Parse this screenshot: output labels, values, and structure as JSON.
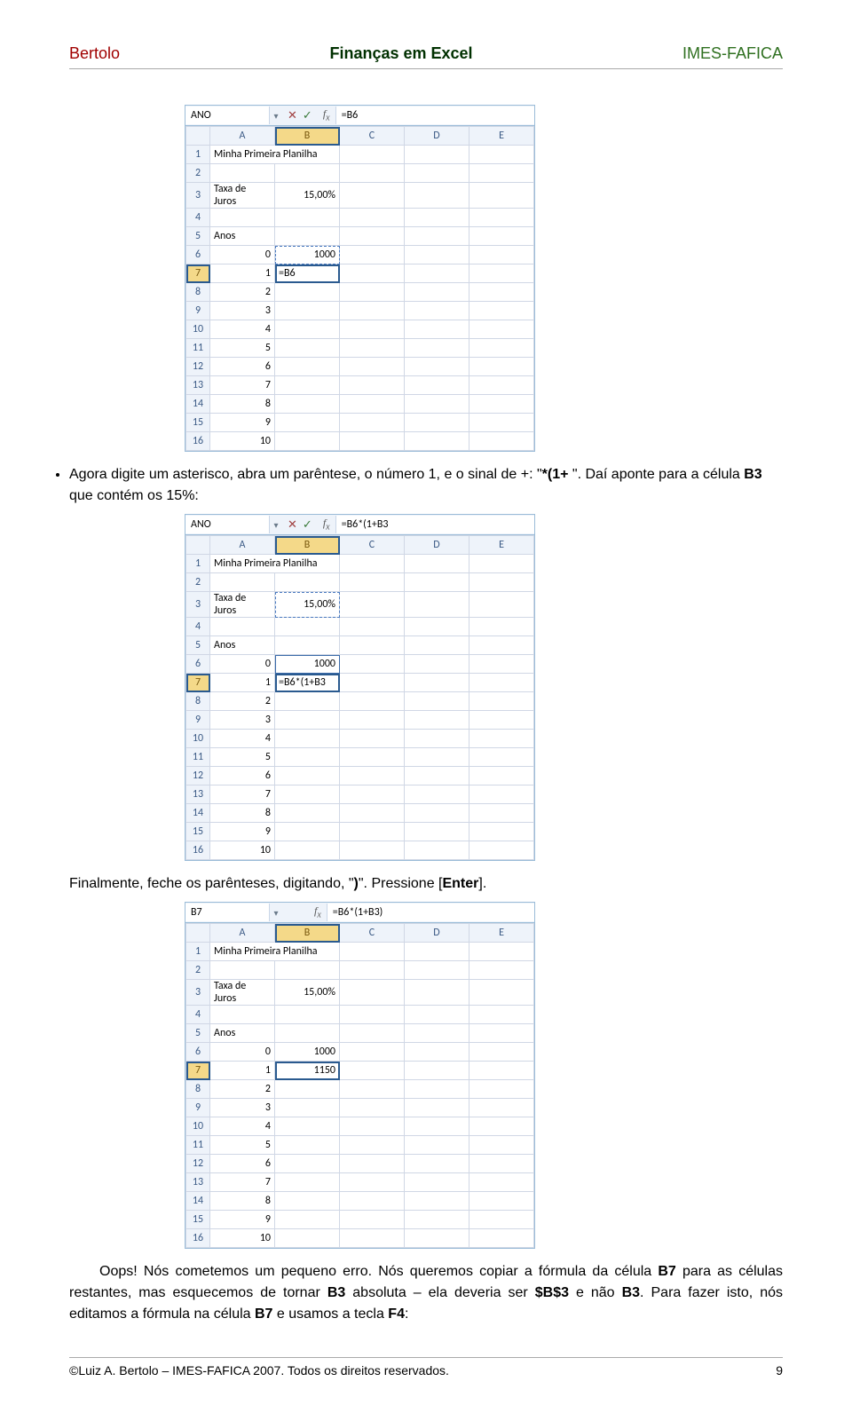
{
  "header": {
    "left": "Bertolo",
    "center": "Finanças em Excel",
    "right": "IMES-FAFICA"
  },
  "excel1": {
    "name": "ANO",
    "formula": "=B6",
    "rows": {
      "r1a": "Minha Primeira Planilha",
      "r3a": "Taxa de Juros",
      "r3b": "15,00%",
      "r5a": "Anos",
      "r6a": "0",
      "r6b": "1000",
      "r7a": "1",
      "r7b": "=B6",
      "r8a": "2",
      "r9a": "3",
      "r10a": "4",
      "r11a": "5",
      "r12a": "6",
      "r13a": "7",
      "r14a": "8",
      "r15a": "9",
      "r16a": "10"
    }
  },
  "bullet1_a": "Agora digite um asterisco, abra um parêntese, o número 1, e o sinal de +: \"",
  "bullet1_code": "*(1+",
  "bullet1_b": " \". Daí aponte para a célula ",
  "bullet1_cell": "B3",
  "bullet1_c": " que contém os 15%:",
  "excel2": {
    "name": "ANO",
    "formula": "=B6*(1+B3",
    "rows": {
      "r1a": "Minha Primeira Planilha",
      "r3a": "Taxa de Juros",
      "r3b": "15,00%",
      "r5a": "Anos",
      "r6a": "0",
      "r6b": "1000",
      "r7a": "1",
      "r7b": "=B6*(1+B3",
      "r8a": "2",
      "r9a": "3",
      "r10a": "4",
      "r11a": "5",
      "r12a": "6",
      "r13a": "7",
      "r14a": "8",
      "r15a": "9",
      "r16a": "10"
    }
  },
  "line2_a": "Finalmente, feche os parênteses, digitando, \"",
  "line2_code": ")",
  "line2_b": "\". Pressione [",
  "line2_enter": "Enter",
  "line2_c": "].",
  "excel3": {
    "name": "B7",
    "formula": "=B6*(1+B3)",
    "rows": {
      "r1a": "Minha Primeira Planilha",
      "r3a": "Taxa de Juros",
      "r3b": "15,00%",
      "r5a": "Anos",
      "r6a": "0",
      "r6b": "1000",
      "r7a": "1",
      "r7b": "1150",
      "r8a": "2",
      "r9a": "3",
      "r10a": "4",
      "r11a": "5",
      "r12a": "6",
      "r13a": "7",
      "r14a": "8",
      "r15a": "9",
      "r16a": "10"
    }
  },
  "para_a": "Oops! Nós cometemos um pequeno erro. Nós queremos copiar a fórmula da célula ",
  "para_b7": "B7",
  "para_b": " para as células restantes, mas esquecemos de tornar ",
  "para_b3a": "B3",
  "para_c": " absoluta – ela deveria ser ",
  "para_abs": "$B$3",
  "para_d": " e não ",
  "para_b3b": "B3",
  "para_e": ". Para fazer isto, nós editamos a fórmula na célula ",
  "para_b7b": "B7",
  "para_f": " e usamos a tecla ",
  "para_f4": "F4",
  "para_g": ":",
  "footer": {
    "left": "©Luiz A. Bertolo – IMES-FAFICA 2007. Todos os direitos reservados.",
    "right": "9"
  },
  "cols": {
    "A": "A",
    "B": "B",
    "C": "C",
    "D": "D",
    "E": "E"
  }
}
